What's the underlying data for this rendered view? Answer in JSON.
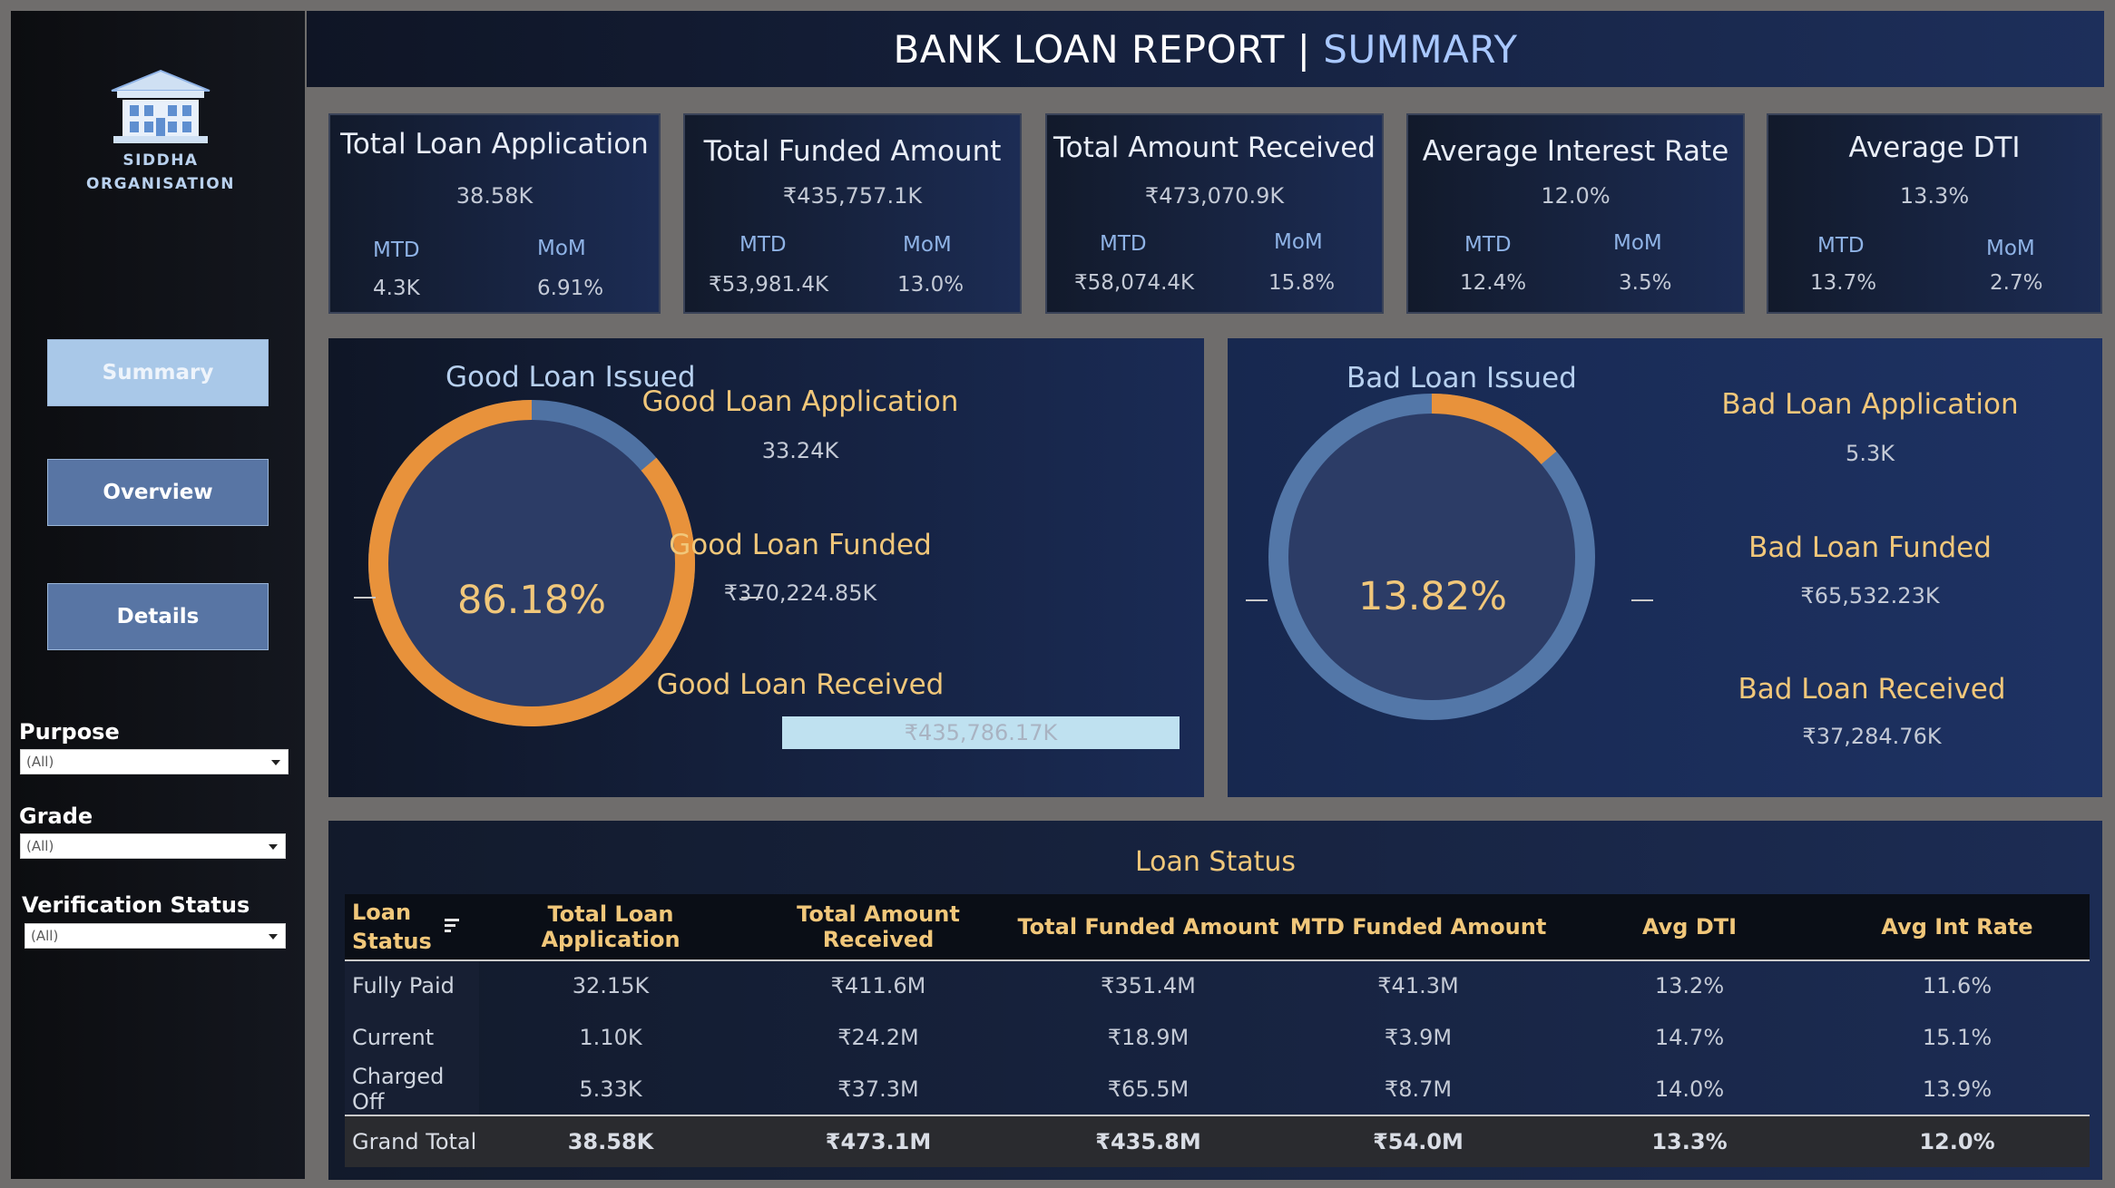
{
  "header": {
    "title": "BANK LOAN REPORT | ",
    "subtitle": "SUMMARY"
  },
  "sidebar": {
    "logo_line1": "SIDDHA",
    "logo_line2": "ORGANISATION",
    "nav": [
      {
        "label": "Summary",
        "active": true
      },
      {
        "label": "Overview",
        "active": false
      },
      {
        "label": "Details",
        "active": false
      }
    ],
    "filters": [
      {
        "label": "Purpose",
        "value": "(All)"
      },
      {
        "label": "Grade",
        "value": "(All)"
      },
      {
        "label": "Verification Status",
        "value": "(All)"
      }
    ]
  },
  "kpis": [
    {
      "title": "Total Loan Application",
      "value": "38.58K",
      "mtd_label": "MTD",
      "mtd": "4.3K",
      "mom_label": "MoM",
      "mom": "6.91%"
    },
    {
      "title": "Total Funded Amount",
      "value": "₹435,757.1K",
      "mtd_label": "MTD",
      "mtd": "₹53,981.4K",
      "mom_label": "MoM",
      "mom": "13.0%"
    },
    {
      "title": "Total Amount Received",
      "value": "₹473,070.9K",
      "mtd_label": "MTD",
      "mtd": "₹58,074.4K",
      "mom_label": "MoM",
      "mom": "15.8%"
    },
    {
      "title": "Average Interest Rate",
      "value": "12.0%",
      "mtd_label": "MTD",
      "mtd": "12.4%",
      "mom_label": "MoM",
      "mom": "3.5%"
    },
    {
      "title": "Average DTI",
      "value": "13.3%",
      "mtd_label": "MTD",
      "mtd": "13.7%",
      "mom_label": "MoM",
      "mom": "2.7%"
    }
  ],
  "good": {
    "title": "Good Loan Issued",
    "pct_label": "86.18%",
    "pct": 0.8618,
    "app_title": "Good Loan Application",
    "app_value": "33.24K",
    "funded_title": "Good Loan Funded",
    "funded_value": "₹370,224.85K",
    "received_title": "Good Loan Received",
    "received_value": "₹435,786.17K"
  },
  "bad": {
    "title": "Bad Loan Issued",
    "pct_label": "13.82%",
    "pct": 0.1382,
    "app_title": "Bad Loan Application",
    "app_value": "5.3K",
    "funded_title": "Bad Loan Funded",
    "funded_value": "₹65,532.23K",
    "received_title": "Bad Loan Received",
    "received_value": "₹37,284.76K"
  },
  "colors": {
    "good_fill": "#e8923b",
    "bad_fill": "#5377a8",
    "accent_gold": "#f1c77a"
  },
  "loan_status": {
    "title": "Loan Status",
    "header_line1": "Loan",
    "header_line2": "Status",
    "columns": [
      "Total Loan Application",
      "Total Amount Received",
      "Total Funded Amount",
      "MTD Funded Amount",
      "Avg DTI",
      "Avg Int Rate"
    ],
    "rows": [
      [
        "Fully Paid",
        "32.15K",
        "₹411.6M",
        "₹351.4M",
        "₹41.3M",
        "13.2%",
        "11.6%"
      ],
      [
        "Current",
        "1.10K",
        "₹24.2M",
        "₹18.9M",
        "₹3.9M",
        "14.7%",
        "15.1%"
      ],
      [
        "Charged Off",
        "5.33K",
        "₹37.3M",
        "₹65.5M",
        "₹8.7M",
        "14.0%",
        "13.9%"
      ]
    ],
    "total": [
      "Grand Total",
      "38.58K",
      "₹473.1M",
      "₹435.8M",
      "₹54.0M",
      "13.3%",
      "12.0%"
    ]
  }
}
